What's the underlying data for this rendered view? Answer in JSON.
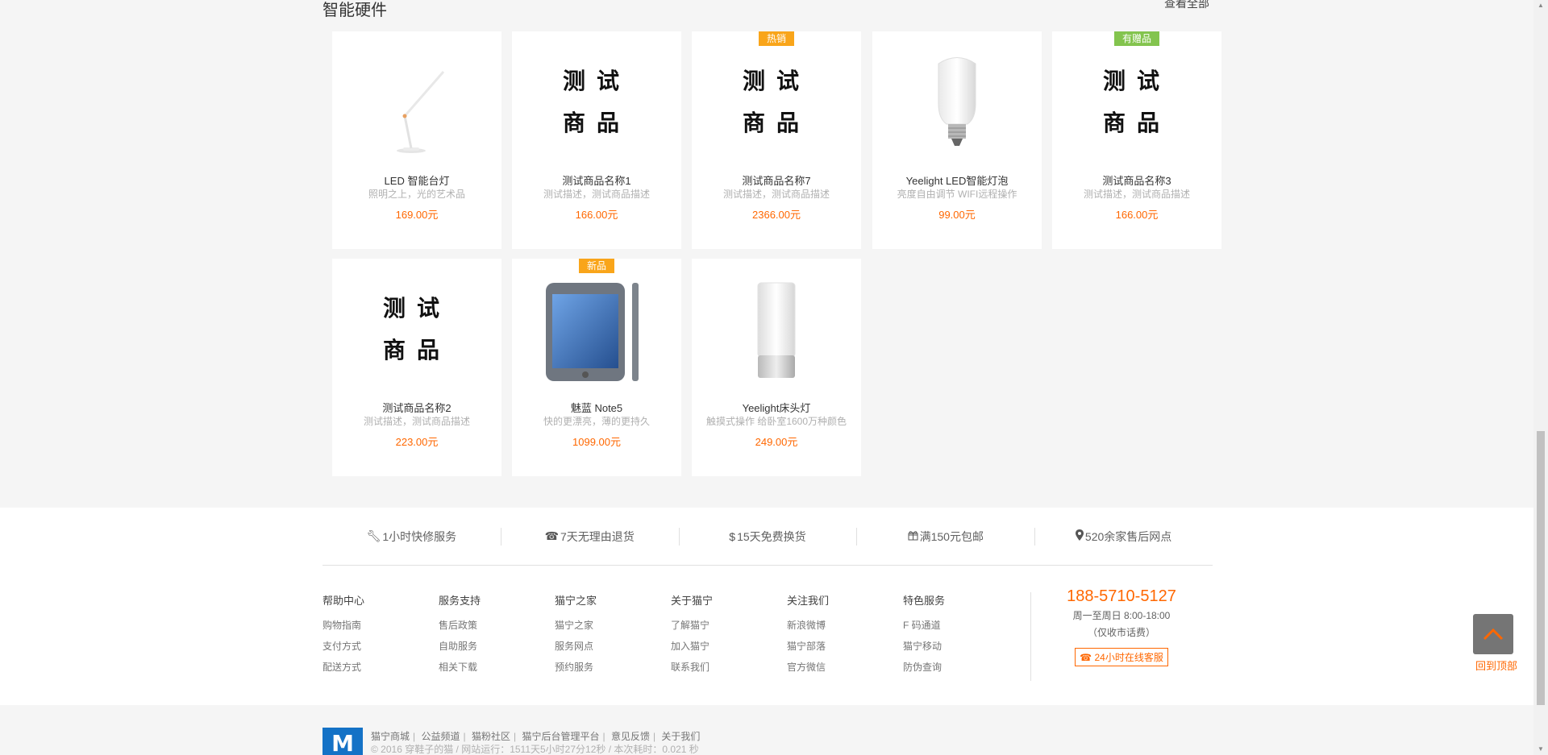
{
  "section": {
    "title": "智能硬件",
    "more": "查看全部"
  },
  "products": [
    {
      "name": "LED 智能台灯",
      "desc": "照明之上，光的艺术品",
      "price": "169.00元",
      "badge": "",
      "image": "desk-lamp"
    },
    {
      "name": "测试商品名称1",
      "desc": "测试描述，测试商品描述",
      "price": "166.00元",
      "badge": "",
      "placeholder": [
        "测试",
        "商品"
      ]
    },
    {
      "name": "测试商品名称7",
      "desc": "测试描述，测试商品描述",
      "price": "2366.00元",
      "badge": "热销",
      "placeholder": [
        "测试",
        "商品"
      ]
    },
    {
      "name": "Yeelight LED智能灯泡",
      "desc": "亮度自由调节 WIFI远程操作",
      "price": "99.00元",
      "badge": "",
      "image": "light-bulb"
    },
    {
      "name": "测试商品名称3",
      "desc": "测试描述，测试商品描述",
      "price": "166.00元",
      "badge": "有赠品",
      "placeholder": [
        "测试",
        "商品"
      ]
    },
    {
      "name": "测试商品名称2",
      "desc": "测试描述，测试商品描述",
      "price": "223.00元",
      "badge": "",
      "placeholder": [
        "测试",
        "商品"
      ]
    },
    {
      "name": "魅蓝 Note5",
      "desc": "快的更漂亮，薄的更持久",
      "price": "1099.00元",
      "badge": "新品",
      "image": "smartphone"
    },
    {
      "name": "Yeelight床头灯",
      "desc": "触摸式操作 给卧室1600万种颜色",
      "price": "249.00元",
      "badge": "",
      "image": "bedside-lamp"
    }
  ],
  "services": [
    {
      "icon": "wrench-icon",
      "label": "1小时快修服务"
    },
    {
      "icon": "phone-icon",
      "label": "7天无理由退货"
    },
    {
      "icon": "dollar-icon",
      "label": "15天免费换货"
    },
    {
      "icon": "gift-icon",
      "label": "满150元包邮"
    },
    {
      "icon": "map-marker-icon",
      "label": "520余家售后网点"
    }
  ],
  "footer_columns": [
    {
      "title": "帮助中心",
      "links": [
        "购物指南",
        "支付方式",
        "配送方式"
      ]
    },
    {
      "title": "服务支持",
      "links": [
        "售后政策",
        "自助服务",
        "相关下载"
      ]
    },
    {
      "title": "猫宁之家",
      "links": [
        "猫宁之家",
        "服务网点",
        "预约服务"
      ]
    },
    {
      "title": "关于猫宁",
      "links": [
        "了解猫宁",
        "加入猫宁",
        "联系我们"
      ]
    },
    {
      "title": "关注我们",
      "links": [
        "新浪微博",
        "猫宁部落",
        "官方微信"
      ]
    },
    {
      "title": "特色服务",
      "links": [
        "F 码通道",
        "猫宁移动",
        "防伪查询"
      ]
    }
  ],
  "contact": {
    "phone": "188-5710-5127",
    "hours": "周一至周日 8:00-18:00",
    "note": "（仅收市话费）",
    "service_button": "24小时在线客服"
  },
  "site_links": [
    "猫宁商城",
    "公益频道",
    "猫粉社区",
    "猫宁后台管理平台",
    "意见反馈",
    "关于我们"
  ],
  "copyright": "© 2016 穿鞋子的猫 / 网站运行：1511天5小时27分12秒 / 本次耗时：0.021 秒",
  "logo_text": "M",
  "back_to_top": "回到顶部",
  "colors": {
    "accent": "#ff6700",
    "badge_hot": "#f9a51a",
    "badge_gift": "#83c44e",
    "logo": "#1472c6"
  }
}
